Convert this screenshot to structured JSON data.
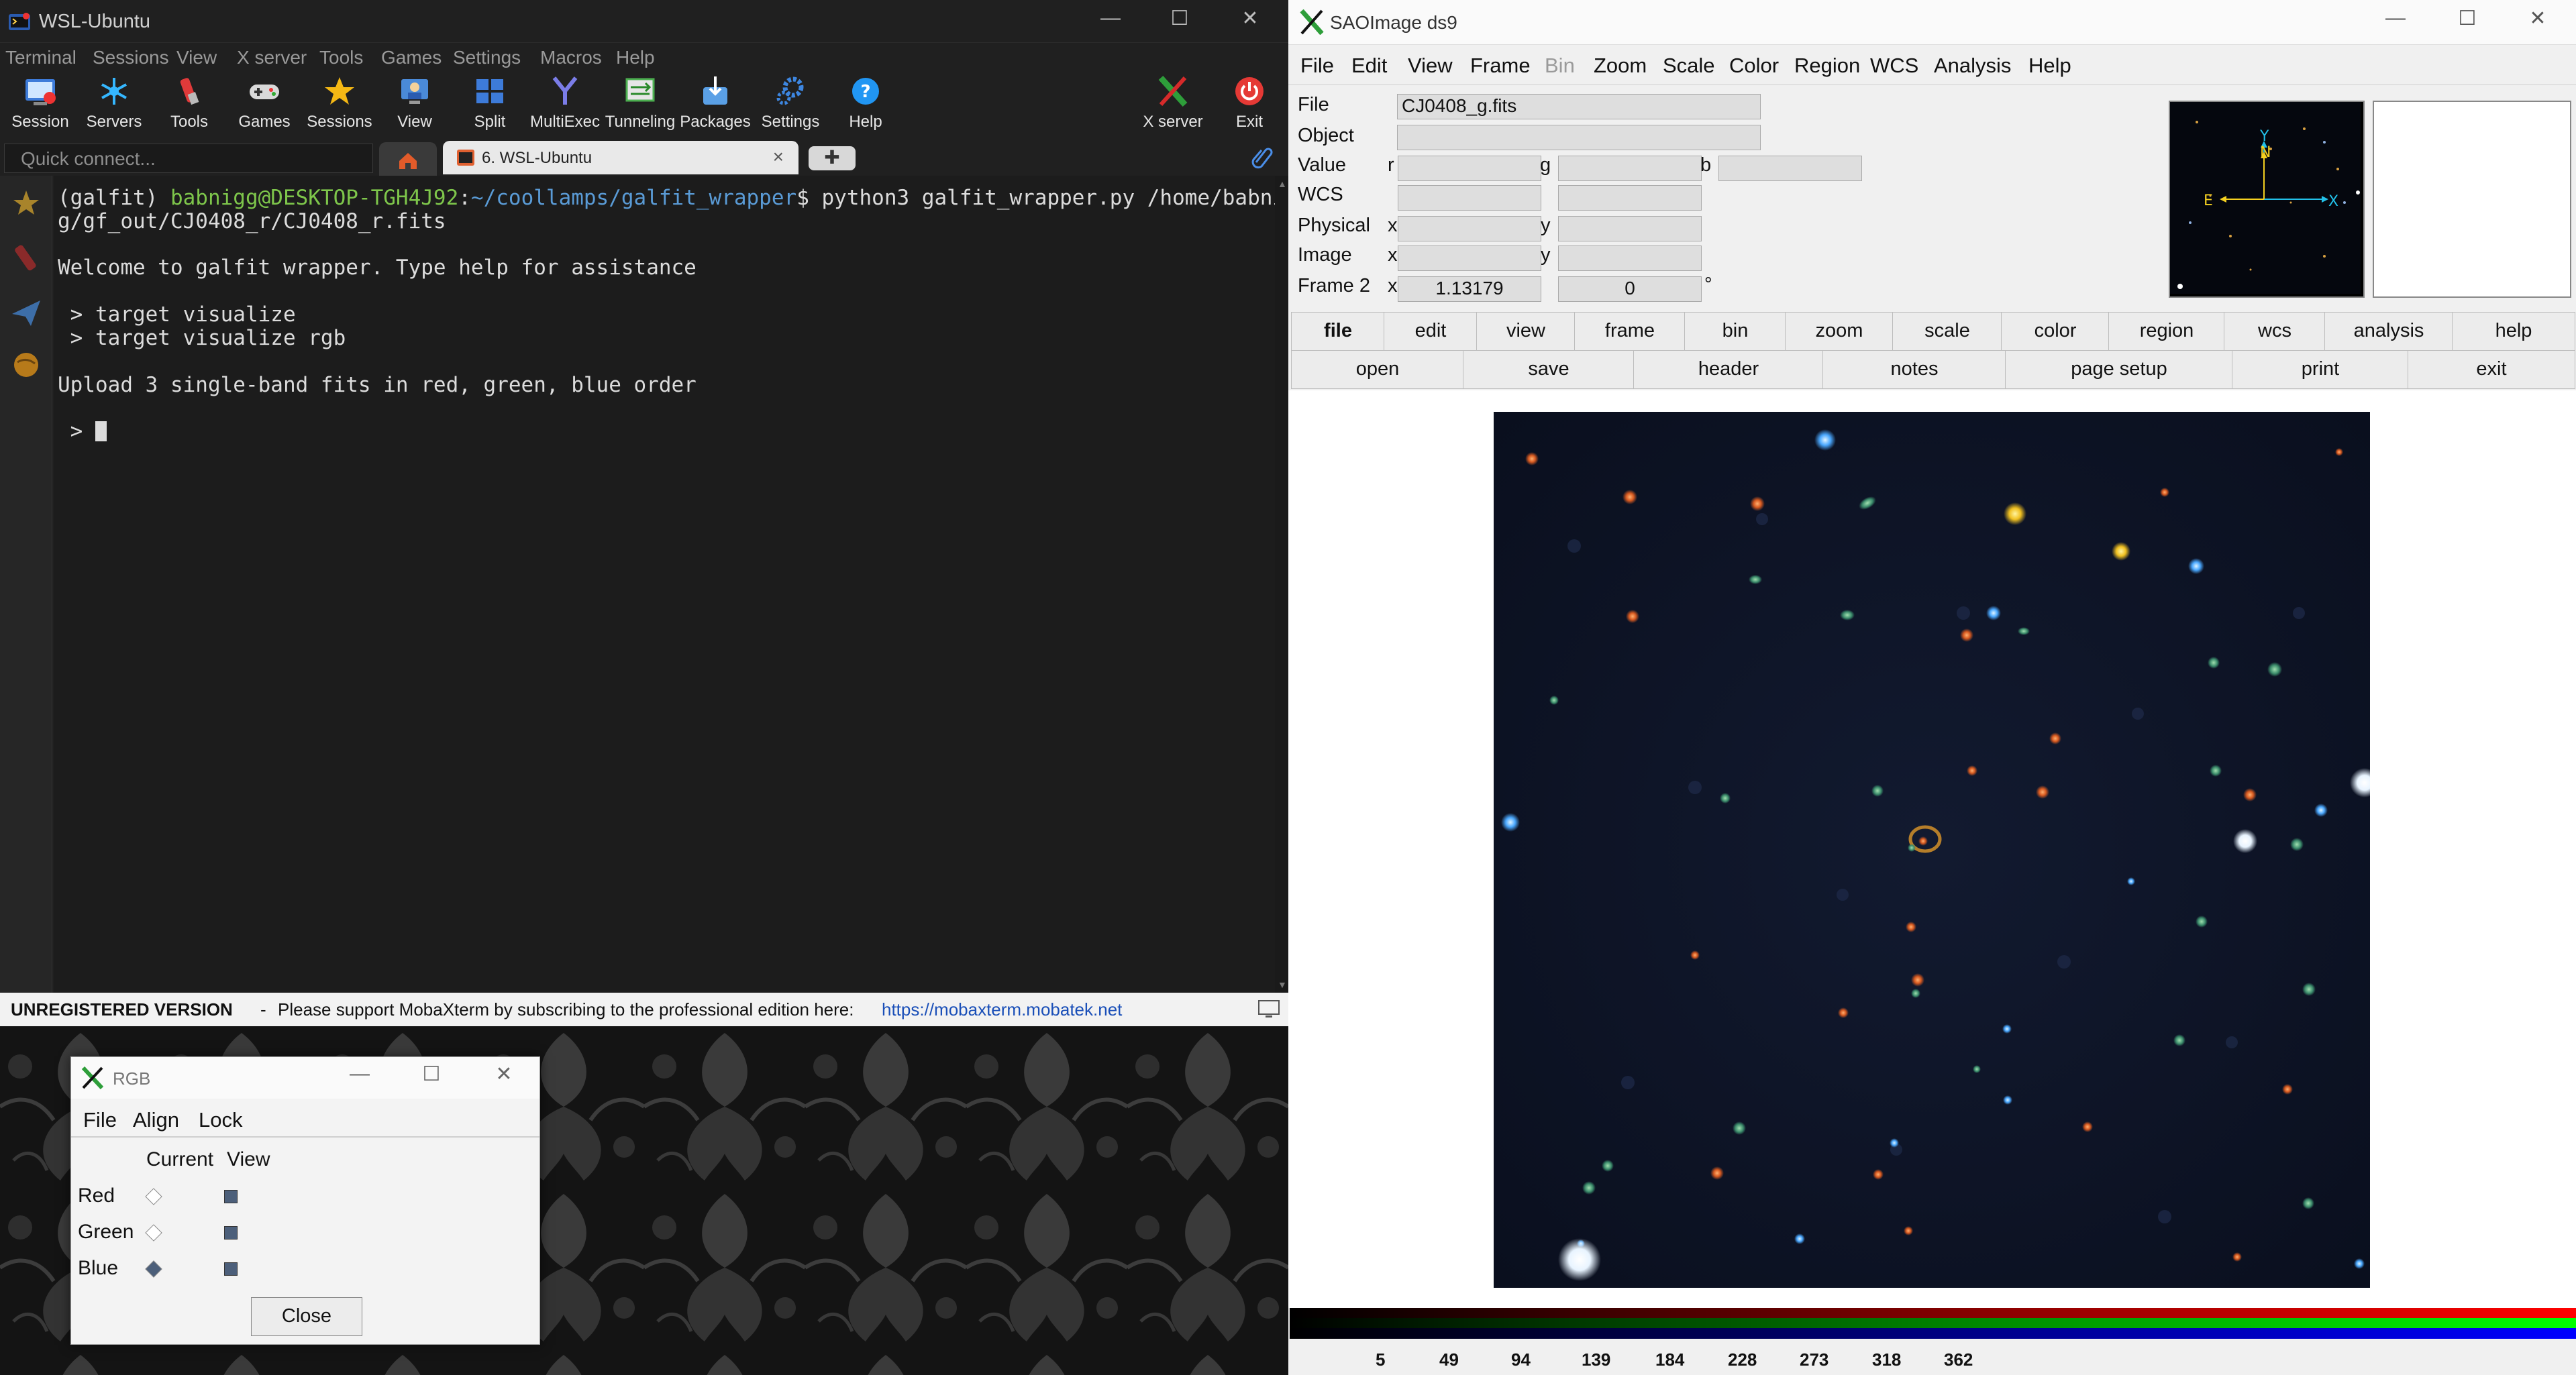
{
  "moba": {
    "window_title": "WSL-Ubuntu",
    "menu": [
      "Terminal",
      "Sessions",
      "View",
      "X server",
      "Tools",
      "Games",
      "Settings",
      "Macros",
      "Help"
    ],
    "toolbar": {
      "session": "Session",
      "servers": "Servers",
      "tools": "Tools",
      "games": "Games",
      "sessions": "Sessions",
      "view": "View",
      "split": "Split",
      "multiexec": "MultiExec",
      "tunneling": "Tunneling",
      "packages": "Packages",
      "settings": "Settings",
      "help": "Help",
      "xserver": "X server",
      "exit": "Exit"
    },
    "quick_connect_placeholder": "Quick connect...",
    "tab_label": "6. WSL-Ubuntu",
    "new_tab": "✚",
    "terminal": {
      "prompt_env": "(galfit) ",
      "prompt_user": "babnigg@DESKTOP-TGH4J92",
      "prompt_colon": ":",
      "prompt_path": "~/coollamps/galfit_wrapper",
      "prompt_cmd": "$ python3 galfit_wrapper.py /home/babnig",
      "line2": "g/gf_out/CJ0408_r/CJ0408_r.fits",
      "line3": "Welcome to galfit wrapper. Type help for assistance",
      "line4": " > target visualize",
      "line5": " > target visualize rgb",
      "line6": "Upload 3 single-band fits in red, green, blue order",
      "line7": " > "
    },
    "status": {
      "unregistered": "UNREGISTERED VERSION",
      "dash": "-",
      "message": "Please support MobaXterm by subscribing to the professional edition here:",
      "link": "https://mobaxterm.mobatek.net"
    }
  },
  "rgb": {
    "title": "RGB",
    "menu": [
      "File",
      "Align",
      "Lock"
    ],
    "col_current": "Current",
    "col_view": "View",
    "rows": [
      "Red",
      "Green",
      "Blue"
    ],
    "close": "Close"
  },
  "ds9": {
    "title": "SAOImage ds9",
    "menu": [
      "File",
      "Edit",
      "View",
      "Frame",
      "Bin",
      "Zoom",
      "Scale",
      "Color",
      "Region",
      "WCS",
      "Analysis",
      "Help"
    ],
    "info": {
      "file_label": "File",
      "file_value": "CJ0408_g.fits",
      "object_label": "Object",
      "value_label": "Value",
      "value_r": "r",
      "value_g": "g",
      "value_b": "b",
      "wcs_label": "WCS",
      "physical_label": "Physical",
      "x": "x",
      "y": "y",
      "image_label": "Image",
      "frame_label": "Frame 2",
      "frame_zoom": "1.13179",
      "frame_angle": "0",
      "degree": "°"
    },
    "panner": {
      "n": "N",
      "e": "E",
      "x": "X",
      "y": "Y"
    },
    "buttons_row1": [
      "file",
      "edit",
      "view",
      "frame",
      "bin",
      "zoom",
      "scale",
      "color",
      "region",
      "wcs",
      "analysis",
      "help"
    ],
    "buttons_row2": [
      "open",
      "save",
      "header",
      "notes",
      "page setup",
      "print",
      "exit"
    ],
    "colorbar_ticks": [
      "5",
      "49",
      "94",
      "139",
      "184",
      "228",
      "273",
      "318",
      "362"
    ]
  }
}
